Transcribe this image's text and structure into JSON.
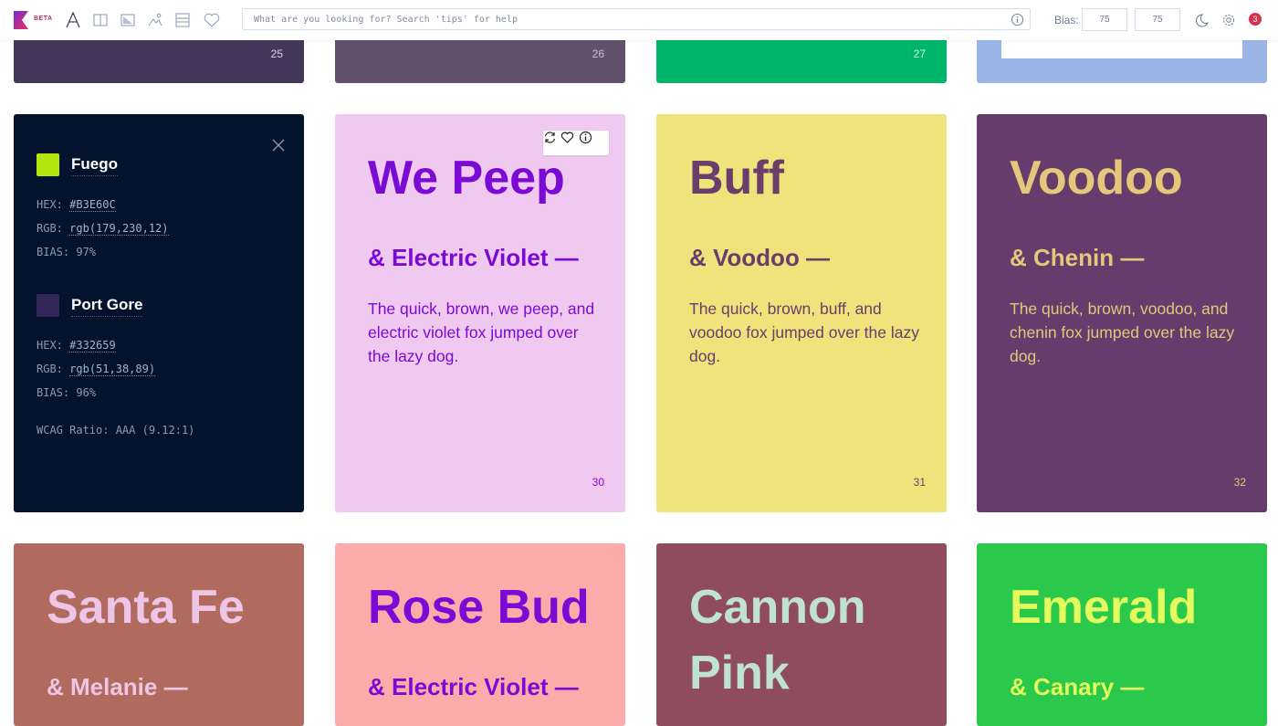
{
  "toolbar": {
    "logo": "K",
    "beta_label": "BETA",
    "tools": [
      "font-icon",
      "columns-icon",
      "gradient-icon",
      "image-icon",
      "rows-icon",
      "heart-icon"
    ],
    "search_placeholder": "What are you looking for? Search 'tips' for help",
    "bias_label": "Bias:",
    "bias_values": [
      "75",
      "75"
    ],
    "notification_count": "3"
  },
  "top_row": [
    {
      "number": "25",
      "bg": "#433859",
      "fg": "#d8d4ea"
    },
    {
      "number": "26",
      "bg": "#62506c",
      "fg": "#c9c2d6"
    },
    {
      "number": "27",
      "bg": "#00b66b",
      "fg": "#d8f4e8"
    },
    {
      "number": "",
      "bg": "#9bb6e6",
      "fg": "#ffffff"
    }
  ],
  "detail_panel": {
    "primary": {
      "name": "Fuego",
      "hex_label": "HEX:",
      "hex": "#B3E60C",
      "rgb_label": "RGB:",
      "rgb": "rgb(179,230,12)",
      "bias_label": "BIAS:",
      "bias": "97%",
      "color": "#b3e60c"
    },
    "secondary": {
      "name": "Port Gore",
      "hex_label": "HEX:",
      "hex": "#332659",
      "rgb_label": "RGB:",
      "rgb": "rgb(51,38,89)",
      "bias_label": "BIAS:",
      "bias": "96%",
      "color": "#332659"
    },
    "wcag": "WCAG Ratio: AAA (9.12:1)"
  },
  "cards": [
    {
      "title": "We Peep",
      "sub": "& Electric Violet —",
      "body": "The quick, brown, we peep, and electric violet fox jumped over the lazy dog.",
      "number": "30",
      "bg": "#f0c9f0",
      "fg": "#7b0ad4"
    },
    {
      "title": "Buff",
      "sub": "& Voodoo —",
      "body": "The quick, brown, buff, and voodoo fox jumped over the lazy dog.",
      "number": "31",
      "bg": "#efe37c",
      "fg": "#6a3d6b"
    },
    {
      "title": "Voodoo",
      "sub": "& Chenin —",
      "body": "The quick, brown, voodoo, and chenin fox jumped over the lazy dog.",
      "number": "32",
      "bg": "#663c6c",
      "fg": "#e4c77a"
    }
  ],
  "bottom_row": [
    {
      "title": "Santa Fe",
      "sub": "& Melanie —",
      "bg": "#b06b5e",
      "fg": "#eec5e6"
    },
    {
      "title": "Rose Bud",
      "sub": "& Electric Violet —",
      "bg": "#fdaaaa",
      "fg": "#7b0ad4"
    },
    {
      "title": "Cannon Pink",
      "sub": "",
      "bg": "#8f4c5d",
      "fg": "#bfe2d2"
    },
    {
      "title": "Emerald",
      "sub": "& Canary —",
      "bg": "#2bc94b",
      "fg": "#e4fb5d"
    }
  ],
  "card_actions": [
    "refresh-icon",
    "heart-icon",
    "info-icon"
  ]
}
